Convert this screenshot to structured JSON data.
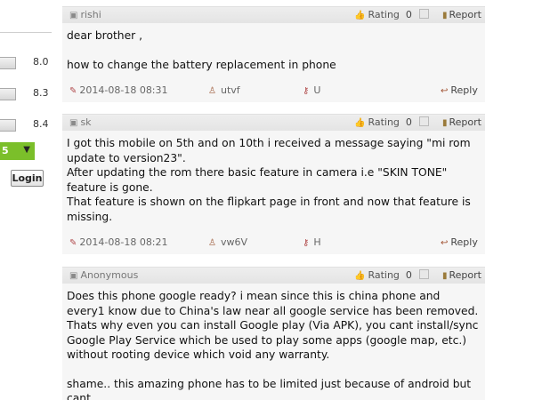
{
  "sidebar": {
    "ratings": [
      "8.0",
      "8.3",
      "8.4"
    ],
    "select_value": "5",
    "select_arrow": "▼",
    "login_label": "Login"
  },
  "comments": [
    {
      "author": "rishi",
      "rating_label": "Rating",
      "rating_value": "0",
      "report_label": "Report",
      "body": [
        "dear brother ,",
        "",
        "how to change the battery replacement in phone"
      ],
      "date": "2014-08-18 08:31",
      "user_code": "utvf",
      "verify_code": "U",
      "reply_label": "Reply"
    },
    {
      "author": "sk",
      "rating_label": "Rating",
      "rating_value": "0",
      "report_label": "Report",
      "body": [
        "I got this mobile on 5th and on 10th i received a message saying \"mi rom update to version23\".",
        "After updating the rom there basic feature in camera i.e \"SKIN TONE\" feature is gone.",
        "That feature is shown on the flipkart page in front and now that feature is missing."
      ],
      "date": "2014-08-18 08:21",
      "user_code": "vw6V",
      "verify_code": "H",
      "reply_label": "Reply"
    },
    {
      "author": "Anonymous",
      "rating_label": "Rating",
      "rating_value": "0",
      "report_label": "Report",
      "body": [
        "Does this phone google ready? i mean since this is china phone and every1 know due to China's law near all google service has been removed. Thats why even you can install Google play (Via APK), you cant install/sync Google Play Service which be used to play some apps (google map, etc.) without rooting device which void any warranty.",
        "",
        "shame.. this amazing phone has to be limited just because of android but cant"
      ]
    }
  ]
}
